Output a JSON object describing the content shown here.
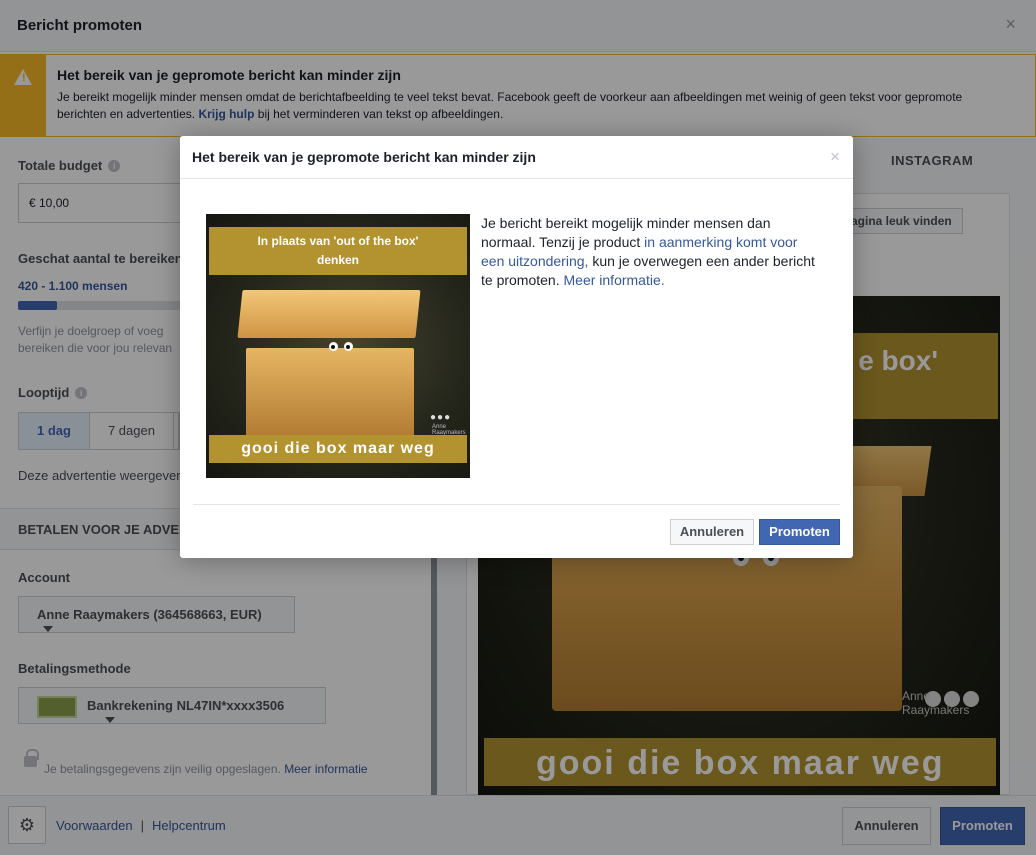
{
  "header": {
    "title": "Bericht promoten",
    "close": "×"
  },
  "warning": {
    "title": "Het bereik van je gepromote bericht kan minder zijn",
    "body": "Je bereikt mogelijk minder mensen omdat de berichtafbeelding te veel tekst bevat. Facebook geeft de voorkeur aan afbeeldingen met weinig of geen tekst voor gepromote berichten en advertenties.",
    "link": "Krijg hulp",
    "body_after": "bij het verminderen van tekst op afbeeldingen."
  },
  "budget": {
    "label": "Totale budget",
    "value": "€ 10,00"
  },
  "reach": {
    "label": "Geschat aantal te bereiken",
    "value": "420 - 1.100 mensen",
    "progress": 0.23,
    "hint_line1": "Verfijn je doelgroep of voeg",
    "hint_line2": "bereiken die voor jou relevan"
  },
  "duration": {
    "label": "Looptijd",
    "options": [
      "1 dag",
      "7 dagen"
    ],
    "selected": "1 dag",
    "note": "Deze advertentie weergever"
  },
  "payment": {
    "section_title": "BETALEN VOOR JE ADVE",
    "account_label": "Account",
    "account_value": "Anne Raaymakers (364568663, EUR)",
    "method_label": "Betalingsmethode",
    "method_value": "Bankrekening NL47IN*xxxx3506",
    "secure_note": "Je betalingsgegevens zijn veilig opgeslagen.",
    "secure_link": "Meer informatie"
  },
  "preview": {
    "tab": "INSTAGRAM",
    "like_button": "agina leuk vinden",
    "image_top_text": "e box'",
    "image_bottom_text": "gooi die box maar weg",
    "image_brand": "Anne Raaymakers"
  },
  "footer": {
    "terms": "Voorwaarden",
    "separator": "|",
    "help": "Helpcentrum",
    "cancel": "Annuleren",
    "promote": "Promoten"
  },
  "modal": {
    "title": "Het bereik van je gepromote bericht kan minder zijn",
    "close": "×",
    "image_top_line1": "In plaats van 'out of the box'",
    "image_top_line2": "denken",
    "image_bottom": "gooi die box maar weg",
    "image_brand": "Anne Raaymakers",
    "text_1": "Je bericht bereikt mogelijk minder mensen dan normaal. Tenzij je product",
    "link_1": "in aanmerking komt voor een uitzondering,",
    "text_2": "kun je overwegen een ander bericht te promoten.",
    "link_2": "Meer informatie.",
    "cancel": "Annuleren",
    "promote": "Promoten"
  },
  "colors": {
    "accent": "#4267b2",
    "warning": "#f7b928",
    "link": "#365899",
    "image_band": "#b3932f"
  }
}
